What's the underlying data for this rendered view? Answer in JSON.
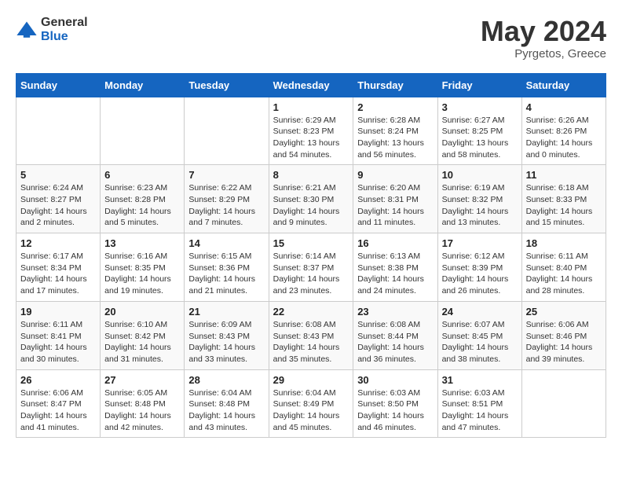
{
  "header": {
    "logo_general": "General",
    "logo_blue": "Blue",
    "month": "May 2024",
    "location": "Pyrgetos, Greece"
  },
  "weekdays": [
    "Sunday",
    "Monday",
    "Tuesday",
    "Wednesday",
    "Thursday",
    "Friday",
    "Saturday"
  ],
  "weeks": [
    [
      null,
      null,
      null,
      {
        "day": "1",
        "sunrise": "Sunrise: 6:29 AM",
        "sunset": "Sunset: 8:23 PM",
        "daylight": "Daylight: 13 hours and 54 minutes."
      },
      {
        "day": "2",
        "sunrise": "Sunrise: 6:28 AM",
        "sunset": "Sunset: 8:24 PM",
        "daylight": "Daylight: 13 hours and 56 minutes."
      },
      {
        "day": "3",
        "sunrise": "Sunrise: 6:27 AM",
        "sunset": "Sunset: 8:25 PM",
        "daylight": "Daylight: 13 hours and 58 minutes."
      },
      {
        "day": "4",
        "sunrise": "Sunrise: 6:26 AM",
        "sunset": "Sunset: 8:26 PM",
        "daylight": "Daylight: 14 hours and 0 minutes."
      }
    ],
    [
      {
        "day": "5",
        "sunrise": "Sunrise: 6:24 AM",
        "sunset": "Sunset: 8:27 PM",
        "daylight": "Daylight: 14 hours and 2 minutes."
      },
      {
        "day": "6",
        "sunrise": "Sunrise: 6:23 AM",
        "sunset": "Sunset: 8:28 PM",
        "daylight": "Daylight: 14 hours and 5 minutes."
      },
      {
        "day": "7",
        "sunrise": "Sunrise: 6:22 AM",
        "sunset": "Sunset: 8:29 PM",
        "daylight": "Daylight: 14 hours and 7 minutes."
      },
      {
        "day": "8",
        "sunrise": "Sunrise: 6:21 AM",
        "sunset": "Sunset: 8:30 PM",
        "daylight": "Daylight: 14 hours and 9 minutes."
      },
      {
        "day": "9",
        "sunrise": "Sunrise: 6:20 AM",
        "sunset": "Sunset: 8:31 PM",
        "daylight": "Daylight: 14 hours and 11 minutes."
      },
      {
        "day": "10",
        "sunrise": "Sunrise: 6:19 AM",
        "sunset": "Sunset: 8:32 PM",
        "daylight": "Daylight: 14 hours and 13 minutes."
      },
      {
        "day": "11",
        "sunrise": "Sunrise: 6:18 AM",
        "sunset": "Sunset: 8:33 PM",
        "daylight": "Daylight: 14 hours and 15 minutes."
      }
    ],
    [
      {
        "day": "12",
        "sunrise": "Sunrise: 6:17 AM",
        "sunset": "Sunset: 8:34 PM",
        "daylight": "Daylight: 14 hours and 17 minutes."
      },
      {
        "day": "13",
        "sunrise": "Sunrise: 6:16 AM",
        "sunset": "Sunset: 8:35 PM",
        "daylight": "Daylight: 14 hours and 19 minutes."
      },
      {
        "day": "14",
        "sunrise": "Sunrise: 6:15 AM",
        "sunset": "Sunset: 8:36 PM",
        "daylight": "Daylight: 14 hours and 21 minutes."
      },
      {
        "day": "15",
        "sunrise": "Sunrise: 6:14 AM",
        "sunset": "Sunset: 8:37 PM",
        "daylight": "Daylight: 14 hours and 23 minutes."
      },
      {
        "day": "16",
        "sunrise": "Sunrise: 6:13 AM",
        "sunset": "Sunset: 8:38 PM",
        "daylight": "Daylight: 14 hours and 24 minutes."
      },
      {
        "day": "17",
        "sunrise": "Sunrise: 6:12 AM",
        "sunset": "Sunset: 8:39 PM",
        "daylight": "Daylight: 14 hours and 26 minutes."
      },
      {
        "day": "18",
        "sunrise": "Sunrise: 6:11 AM",
        "sunset": "Sunset: 8:40 PM",
        "daylight": "Daylight: 14 hours and 28 minutes."
      }
    ],
    [
      {
        "day": "19",
        "sunrise": "Sunrise: 6:11 AM",
        "sunset": "Sunset: 8:41 PM",
        "daylight": "Daylight: 14 hours and 30 minutes."
      },
      {
        "day": "20",
        "sunrise": "Sunrise: 6:10 AM",
        "sunset": "Sunset: 8:42 PM",
        "daylight": "Daylight: 14 hours and 31 minutes."
      },
      {
        "day": "21",
        "sunrise": "Sunrise: 6:09 AM",
        "sunset": "Sunset: 8:43 PM",
        "daylight": "Daylight: 14 hours and 33 minutes."
      },
      {
        "day": "22",
        "sunrise": "Sunrise: 6:08 AM",
        "sunset": "Sunset: 8:43 PM",
        "daylight": "Daylight: 14 hours and 35 minutes."
      },
      {
        "day": "23",
        "sunrise": "Sunrise: 6:08 AM",
        "sunset": "Sunset: 8:44 PM",
        "daylight": "Daylight: 14 hours and 36 minutes."
      },
      {
        "day": "24",
        "sunrise": "Sunrise: 6:07 AM",
        "sunset": "Sunset: 8:45 PM",
        "daylight": "Daylight: 14 hours and 38 minutes."
      },
      {
        "day": "25",
        "sunrise": "Sunrise: 6:06 AM",
        "sunset": "Sunset: 8:46 PM",
        "daylight": "Daylight: 14 hours and 39 minutes."
      }
    ],
    [
      {
        "day": "26",
        "sunrise": "Sunrise: 6:06 AM",
        "sunset": "Sunset: 8:47 PM",
        "daylight": "Daylight: 14 hours and 41 minutes."
      },
      {
        "day": "27",
        "sunrise": "Sunrise: 6:05 AM",
        "sunset": "Sunset: 8:48 PM",
        "daylight": "Daylight: 14 hours and 42 minutes."
      },
      {
        "day": "28",
        "sunrise": "Sunrise: 6:04 AM",
        "sunset": "Sunset: 8:48 PM",
        "daylight": "Daylight: 14 hours and 43 minutes."
      },
      {
        "day": "29",
        "sunrise": "Sunrise: 6:04 AM",
        "sunset": "Sunset: 8:49 PM",
        "daylight": "Daylight: 14 hours and 45 minutes."
      },
      {
        "day": "30",
        "sunrise": "Sunrise: 6:03 AM",
        "sunset": "Sunset: 8:50 PM",
        "daylight": "Daylight: 14 hours and 46 minutes."
      },
      {
        "day": "31",
        "sunrise": "Sunrise: 6:03 AM",
        "sunset": "Sunset: 8:51 PM",
        "daylight": "Daylight: 14 hours and 47 minutes."
      },
      null
    ]
  ]
}
